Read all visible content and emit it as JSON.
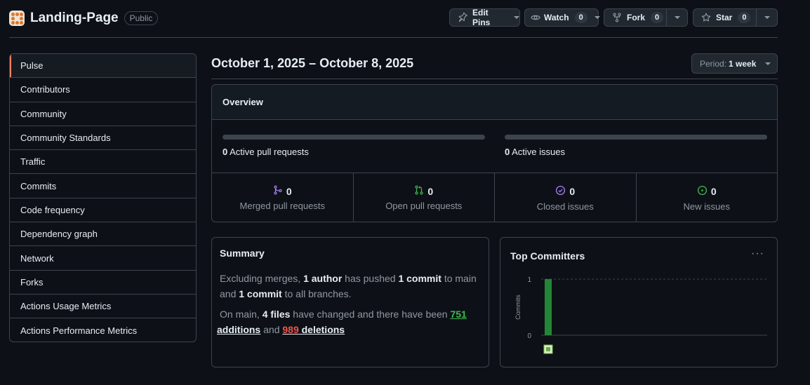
{
  "repo": {
    "name": "Landing-Page",
    "visibility": "Public"
  },
  "actions": {
    "edit_pins": "Edit Pins",
    "watch": {
      "label": "Watch",
      "count": "0"
    },
    "fork": {
      "label": "Fork",
      "count": "0"
    },
    "star": {
      "label": "Star",
      "count": "0"
    }
  },
  "sidebar": {
    "items": [
      {
        "label": "Pulse",
        "active": true
      },
      {
        "label": "Contributors"
      },
      {
        "label": "Community"
      },
      {
        "label": "Community Standards"
      },
      {
        "label": "Traffic"
      },
      {
        "label": "Commits"
      },
      {
        "label": "Code frequency"
      },
      {
        "label": "Dependency graph"
      },
      {
        "label": "Network"
      },
      {
        "label": "Forks"
      },
      {
        "label": "Actions Usage Metrics"
      },
      {
        "label": "Actions Performance Metrics"
      }
    ]
  },
  "main": {
    "date_range": "October 1, 2025 – October 8, 2025",
    "period": {
      "label": "Period:",
      "value": "1 week"
    }
  },
  "overview": {
    "title": "Overview",
    "pull_requests": {
      "count": "0",
      "label": "Active pull requests",
      "fill_fraction": 0
    },
    "issues": {
      "count": "0",
      "label": "Active issues",
      "fill_fraction": 0
    },
    "stats": [
      {
        "icon": "merged-pr-icon",
        "count": "0",
        "label": "Merged pull requests",
        "color": "#ab7df8"
      },
      {
        "icon": "open-pr-icon",
        "count": "0",
        "label": "Open pull requests",
        "color": "#3fb950"
      },
      {
        "icon": "closed-issue-icon",
        "count": "0",
        "label": "Closed issues",
        "color": "#ab7df8"
      },
      {
        "icon": "open-issue-icon",
        "count": "0",
        "label": "New issues",
        "color": "#3fb950"
      }
    ]
  },
  "summary": {
    "title": "Summary",
    "line1": {
      "a": "Excluding merges, ",
      "b": "1 author",
      "c": " has pushed ",
      "d": "1 commit",
      "e": " to main and ",
      "f": "1 commit",
      "g": " to all branches."
    },
    "line2": {
      "a": "On main, ",
      "b": "4 files",
      "c": " have changed and there have been ",
      "d": "751",
      "e": " additions",
      "f": " and ",
      "g": "989",
      "h": " deletions"
    }
  },
  "top_committers": {
    "title": "Top Committers",
    "more_label": "···"
  },
  "chart_data": {
    "type": "bar",
    "categories": [
      ""
    ],
    "values": [
      1
    ],
    "ylabel": "Commits",
    "yticks": [
      "0",
      "1"
    ],
    "ylim": [
      0,
      1
    ],
    "bar_color": "#238636",
    "grid": true
  }
}
